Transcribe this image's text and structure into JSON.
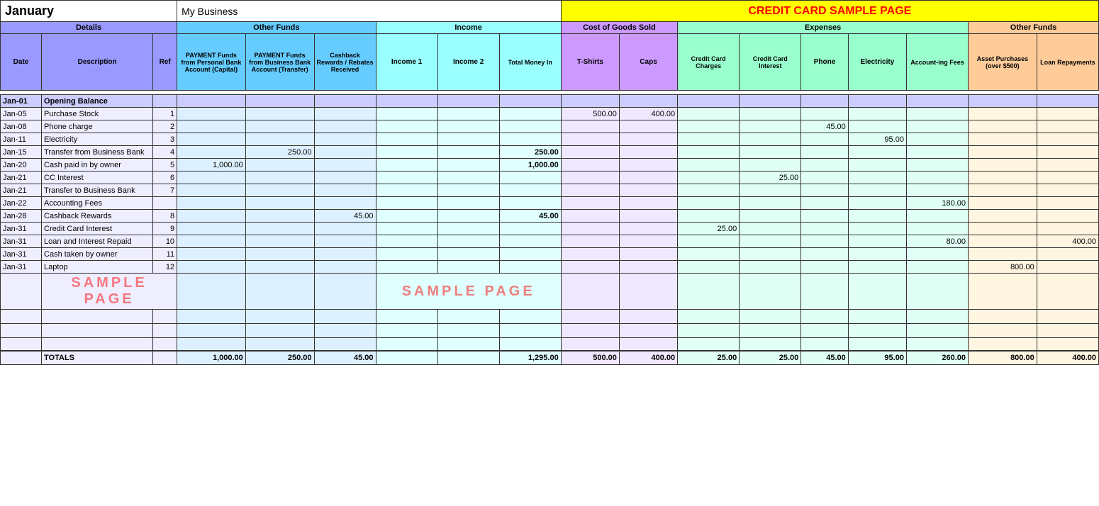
{
  "header": {
    "month": "January",
    "business": "My Business",
    "credit_title": "CREDIT CARD SAMPLE PAGE"
  },
  "sections": {
    "details": "Details",
    "other_funds": "Other Funds",
    "income": "Income",
    "cogs": "Cost of Goods Sold",
    "expenses": "Expenses",
    "other_funds2": "Other Funds"
  },
  "col_headers": {
    "date": "Date",
    "description": "Description",
    "ref": "Ref",
    "pay_personal": "PAYMENT Funds from Personal Bank Account (Capital)",
    "pay_business": "PAYMENT Funds from Business Bank Account (Transfer)",
    "cashback": "Cashback Rewards / Rebates Received",
    "income1": "Income 1",
    "income2": "Income 2",
    "total_money": "Total Money In",
    "tshirts": "T-Shirts",
    "caps": "Caps",
    "cc_charges": "Credit Card Charges",
    "cc_interest": "Credit Card Interest",
    "phone": "Phone",
    "electricity": "Electricity",
    "accounting": "Account-ing Fees",
    "asset": "Asset Purchases (over $500)",
    "loan": "Loan Repayments"
  },
  "rows": [
    {
      "date": "Jan-01",
      "desc": "Opening Balance",
      "ref": "",
      "pay_personal": "",
      "pay_business": "",
      "cashback": "",
      "income1": "",
      "income2": "",
      "total_money": "",
      "tshirts": "",
      "caps": "",
      "cc_charges": "",
      "cc_interest": "",
      "phone": "",
      "electricity": "",
      "accounting": "",
      "asset": "",
      "loan": "",
      "type": "opening"
    },
    {
      "date": "Jan-05",
      "desc": "Purchase Stock",
      "ref": "1",
      "pay_personal": "",
      "pay_business": "",
      "cashback": "",
      "income1": "",
      "income2": "",
      "total_money": "",
      "tshirts": "500.00",
      "caps": "400.00",
      "cc_charges": "",
      "cc_interest": "",
      "phone": "",
      "electricity": "",
      "accounting": "",
      "asset": "",
      "loan": "",
      "type": "data"
    },
    {
      "date": "Jan-08",
      "desc": "Phone charge",
      "ref": "2",
      "pay_personal": "",
      "pay_business": "",
      "cashback": "",
      "income1": "",
      "income2": "",
      "total_money": "",
      "tshirts": "",
      "caps": "",
      "cc_charges": "",
      "cc_interest": "",
      "phone": "45.00",
      "electricity": "",
      "accounting": "",
      "asset": "",
      "loan": "",
      "type": "data"
    },
    {
      "date": "Jan-11",
      "desc": "Electricity",
      "ref": "3",
      "pay_personal": "",
      "pay_business": "",
      "cashback": "",
      "income1": "",
      "income2": "",
      "total_money": "",
      "tshirts": "",
      "caps": "",
      "cc_charges": "",
      "cc_interest": "",
      "phone": "",
      "electricity": "95.00",
      "accounting": "",
      "asset": "",
      "loan": "",
      "type": "data"
    },
    {
      "date": "Jan-15",
      "desc": "Transfer from Business Bank",
      "ref": "4",
      "pay_personal": "",
      "pay_business": "250.00",
      "cashback": "",
      "income1": "",
      "income2": "",
      "total_money": "250.00",
      "tshirts": "",
      "caps": "",
      "cc_charges": "",
      "cc_interest": "",
      "phone": "",
      "electricity": "",
      "accounting": "",
      "asset": "",
      "loan": "",
      "type": "data",
      "total_bold": true
    },
    {
      "date": "Jan-20",
      "desc": "Cash paid in by owner",
      "ref": "5",
      "pay_personal": "1,000.00",
      "pay_business": "",
      "cashback": "",
      "income1": "",
      "income2": "",
      "total_money": "1,000.00",
      "tshirts": "",
      "caps": "",
      "cc_charges": "",
      "cc_interest": "",
      "phone": "",
      "electricity": "",
      "accounting": "",
      "asset": "",
      "loan": "",
      "type": "data",
      "total_bold": true
    },
    {
      "date": "Jan-21",
      "desc": "CC Interest",
      "ref": "6",
      "pay_personal": "",
      "pay_business": "",
      "cashback": "",
      "income1": "",
      "income2": "",
      "total_money": "",
      "tshirts": "",
      "caps": "",
      "cc_charges": "",
      "cc_interest": "25.00",
      "phone": "",
      "electricity": "",
      "accounting": "",
      "asset": "",
      "loan": "",
      "type": "data"
    },
    {
      "date": "Jan-21",
      "desc": "Transfer to Business Bank",
      "ref": "7",
      "pay_personal": "",
      "pay_business": "",
      "cashback": "",
      "income1": "",
      "income2": "",
      "total_money": "",
      "tshirts": "",
      "caps": "",
      "cc_charges": "",
      "cc_interest": "",
      "phone": "",
      "electricity": "",
      "accounting": "",
      "asset": "",
      "loan": "",
      "type": "data"
    },
    {
      "date": "Jan-22",
      "desc": "Accounting Fees",
      "ref": "",
      "pay_personal": "",
      "pay_business": "",
      "cashback": "",
      "income1": "",
      "income2": "",
      "total_money": "",
      "tshirts": "",
      "caps": "",
      "cc_charges": "",
      "cc_interest": "",
      "phone": "",
      "electricity": "",
      "accounting": "180.00",
      "asset": "",
      "loan": "",
      "type": "data"
    },
    {
      "date": "Jan-28",
      "desc": "Cashback Rewards",
      "ref": "8",
      "pay_personal": "",
      "pay_business": "",
      "cashback": "45.00",
      "income1": "",
      "income2": "",
      "total_money": "45.00",
      "tshirts": "",
      "caps": "",
      "cc_charges": "",
      "cc_interest": "",
      "phone": "",
      "electricity": "",
      "accounting": "",
      "asset": "",
      "loan": "",
      "type": "data",
      "total_bold": true
    },
    {
      "date": "Jan-31",
      "desc": "Credit Card Interest",
      "ref": "9",
      "pay_personal": "",
      "pay_business": "",
      "cashback": "",
      "income1": "",
      "income2": "",
      "total_money": "",
      "tshirts": "",
      "caps": "",
      "cc_charges": "25.00",
      "cc_interest": "",
      "phone": "",
      "electricity": "",
      "accounting": "",
      "asset": "",
      "loan": "",
      "type": "data"
    },
    {
      "date": "Jan-31",
      "desc": "Loan and Interest Repaid",
      "ref": "10",
      "pay_personal": "",
      "pay_business": "",
      "cashback": "",
      "income1": "",
      "income2": "",
      "total_money": "",
      "tshirts": "",
      "caps": "",
      "cc_charges": "",
      "cc_interest": "",
      "phone": "",
      "electricity": "",
      "accounting": "80.00",
      "asset": "",
      "loan": "400.00",
      "type": "data"
    },
    {
      "date": "Jan-31",
      "desc": "Cash taken by owner",
      "ref": "11",
      "pay_personal": "",
      "pay_business": "",
      "cashback": "",
      "income1": "",
      "income2": "",
      "total_money": "",
      "tshirts": "",
      "caps": "",
      "cc_charges": "",
      "cc_interest": "",
      "phone": "",
      "electricity": "",
      "accounting": "",
      "asset": "",
      "loan": "",
      "type": "data"
    },
    {
      "date": "Jan-31",
      "desc": "Laptop",
      "ref": "12",
      "pay_personal": "",
      "pay_business": "",
      "cashback": "",
      "income1": "",
      "income2": "",
      "total_money": "",
      "tshirts": "",
      "caps": "",
      "cc_charges": "",
      "cc_interest": "",
      "phone": "",
      "electricity": "",
      "accounting": "",
      "asset": "800.00",
      "loan": "",
      "type": "data"
    }
  ],
  "sample_rows": 3,
  "totals": {
    "label": "TOTALS",
    "pay_personal": "1,000.00",
    "pay_business": "250.00",
    "cashback": "45.00",
    "income1": "",
    "income2": "",
    "total_money": "1,295.00",
    "tshirts": "500.00",
    "caps": "400.00",
    "cc_charges": "25.00",
    "cc_interest": "25.00",
    "phone": "45.00",
    "electricity": "95.00",
    "accounting": "260.00",
    "asset": "800.00",
    "loan": "400.00"
  }
}
